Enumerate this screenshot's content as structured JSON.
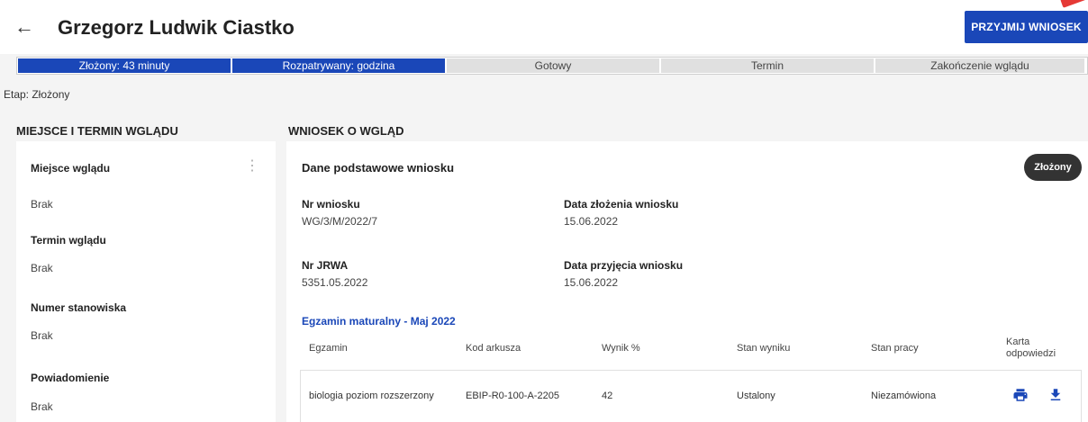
{
  "header": {
    "back_icon": "arrow-left-icon",
    "title": "Grzegorz Ludwik Ciastko",
    "accept_label": "PRZYJMIJ WNIOSEK"
  },
  "progress": {
    "steps": [
      {
        "label": "Złożony: 43 minuty",
        "active": true
      },
      {
        "label": "Rozpatrywany: godzina",
        "active": true
      },
      {
        "label": "Gotowy",
        "active": false
      },
      {
        "label": "Termin",
        "active": false
      },
      {
        "label": "Zakończenie wglądu",
        "active": false
      }
    ]
  },
  "etap": "Etap: Złożony",
  "left": {
    "section_title": "MIEJSCE I TERMIN WGLĄDU",
    "fields": [
      {
        "label": "Miejsce wglądu",
        "value": "Brak"
      },
      {
        "label": "Termin wglądu",
        "value": "Brak"
      },
      {
        "label": "Numer stanowiska",
        "value": "Brak"
      },
      {
        "label": "Powiadomienie",
        "value": "Brak"
      }
    ]
  },
  "right": {
    "section_title": "WNIOSEK O WGLĄD",
    "card_title": "Dane podstawowe wniosku",
    "status_chip": "Złożony",
    "details": {
      "nr_wniosku_label": "Nr wniosku",
      "nr_wniosku": "WG/3/M/2022/7",
      "data_zlozenia_label": "Data złożenia wniosku",
      "data_zlozenia": "15.06.2022",
      "nr_jrwa_label": "Nr JRWA",
      "nr_jrwa": "5351.05.2022",
      "data_przyjecia_label": "Data przyjęcia wniosku",
      "data_przyjecia": "15.06.2022"
    },
    "exam_title": "Egzamin maturalny - Maj 2022",
    "table": {
      "headers": {
        "egzamin": "Egzamin",
        "kod": "Kod arkusza",
        "wynik": "Wynik %",
        "stan_wyniku": "Stan wyniku",
        "stan_pracy": "Stan pracy",
        "karta_1": "Karta",
        "karta_2": "odpowiedzi"
      },
      "rows": [
        {
          "egzamin": "biologia poziom rozszerzony",
          "kod": "EBIP-R0-100-A-2205",
          "wynik": "42",
          "stan_wyniku": "Ustalony",
          "stan_pracy": "Niezamówiona",
          "actions": [
            "print-icon",
            "download-icon"
          ]
        }
      ]
    }
  },
  "colors": {
    "accent": "#1a47b8",
    "chip": "#333333",
    "background": "#f4f4f4"
  }
}
